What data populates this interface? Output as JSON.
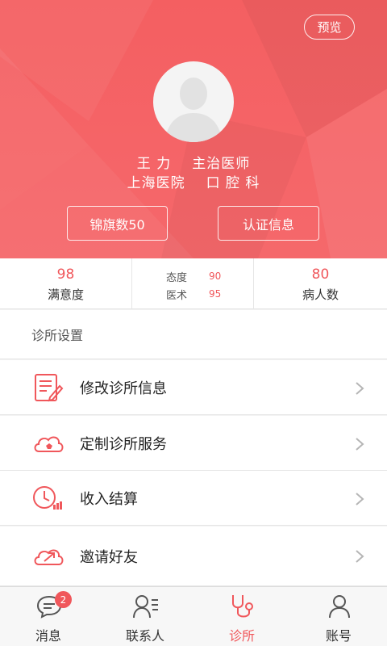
{
  "header": {
    "preview_label": "预览",
    "doctor_name": "王 力",
    "doctor_title": "主治医师",
    "hospital": "上海医院",
    "department": "口 腔 科",
    "banner_button": "锦旗数50",
    "cert_button": "认证信息",
    "accent_color": "#f45f61"
  },
  "stats": {
    "satisfaction_value": "98",
    "satisfaction_label": "满意度",
    "attitude_label": "态度",
    "attitude_value": "90",
    "skill_label": "医术",
    "skill_value": "95",
    "patients_value": "80",
    "patients_label": "病人数"
  },
  "settings": {
    "section_title": "诊所设置",
    "items": [
      {
        "label": "修改诊所信息",
        "icon": "edit-document-icon"
      },
      {
        "label": "定制诊所服务",
        "icon": "cloud-service-icon"
      },
      {
        "label": "收入结算",
        "icon": "clock-income-icon"
      },
      {
        "label": "邀请好友",
        "icon": "cloud-share-icon"
      }
    ]
  },
  "tabbar": {
    "items": [
      {
        "label": "消息",
        "icon": "message-icon",
        "badge": "2"
      },
      {
        "label": "联系人",
        "icon": "contacts-icon"
      },
      {
        "label": "诊所",
        "icon": "stethoscope-icon",
        "active": true
      },
      {
        "label": "账号",
        "icon": "account-icon"
      }
    ]
  }
}
